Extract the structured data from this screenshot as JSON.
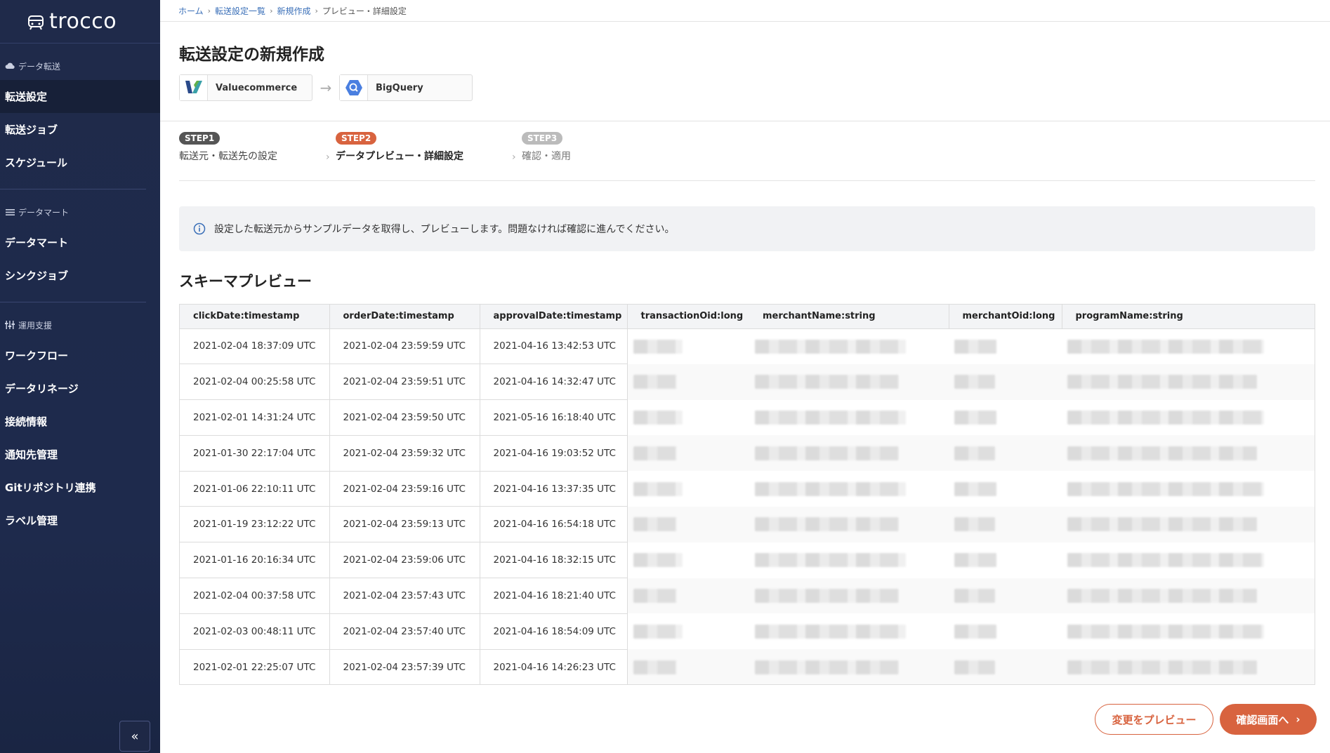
{
  "app": {
    "logo_text": "trocco"
  },
  "sidebar": {
    "sections": [
      {
        "heading": "データ転送",
        "icon": "cloud-icon",
        "items": [
          {
            "label": "転送設定",
            "active": true
          },
          {
            "label": "転送ジョブ"
          },
          {
            "label": "スケジュール"
          }
        ]
      },
      {
        "heading": "データマート",
        "icon": "list-icon",
        "items": [
          {
            "label": "データマート"
          },
          {
            "label": "シンクジョブ"
          }
        ]
      },
      {
        "heading": "運用支援",
        "icon": "sliders-icon",
        "items": [
          {
            "label": "ワークフロー"
          },
          {
            "label": "データリネージ"
          },
          {
            "label": "接続情報"
          },
          {
            "label": "通知先管理"
          },
          {
            "label": "Gitリポジトリ連携"
          },
          {
            "label": "ラベル管理"
          }
        ]
      }
    ],
    "collapse_glyph": "«"
  },
  "breadcrumb": [
    "ホーム",
    "転送設定一覧",
    "新規作成",
    "プレビュー・詳細設定"
  ],
  "page_title": "転送設定の新規作成",
  "connectors": {
    "source": "Valuecommerce",
    "destination": "BigQuery"
  },
  "steps": [
    {
      "badge": "STEP1",
      "label": "転送元・転送先の設定",
      "state": "done"
    },
    {
      "badge": "STEP2",
      "label": "データプレビュー・詳細設定",
      "state": "current"
    },
    {
      "badge": "STEP3",
      "label": "確認・適用",
      "state": "pending"
    }
  ],
  "info_message": "設定した転送元からサンプルデータを取得し、プレビューします。問題なければ確認に進んでください。",
  "schema_title": "スキーマプレビュー",
  "table": {
    "columns": [
      "clickDate:timestamp",
      "orderDate:timestamp",
      "approvalDate:timestamp",
      "transactionOid:long",
      "merchantName:string",
      "merchantOid:long",
      "programName:string"
    ],
    "rows": [
      [
        "2021-02-04 18:37:09 UTC",
        "2021-02-04 23:59:59 UTC",
        "2021-04-16 13:42:53 UTC"
      ],
      [
        "2021-02-04 00:25:58 UTC",
        "2021-02-04 23:59:51 UTC",
        "2021-04-16 14:32:47 UTC"
      ],
      [
        "2021-02-01 14:31:24 UTC",
        "2021-02-04 23:59:50 UTC",
        "2021-05-16 16:18:40 UTC"
      ],
      [
        "2021-01-30 22:17:04 UTC",
        "2021-02-04 23:59:32 UTC",
        "2021-04-16 19:03:52 UTC"
      ],
      [
        "2021-01-06 22:10:11 UTC",
        "2021-02-04 23:59:16 UTC",
        "2021-04-16 13:37:35 UTC"
      ],
      [
        "2021-01-19 23:12:22 UTC",
        "2021-02-04 23:59:13 UTC",
        "2021-04-16 16:54:18 UTC"
      ],
      [
        "2021-01-16 20:16:34 UTC",
        "2021-02-04 23:59:06 UTC",
        "2021-04-16 18:32:15 UTC"
      ],
      [
        "2021-02-04 00:37:58 UTC",
        "2021-02-04 23:57:43 UTC",
        "2021-04-16 18:21:40 UTC"
      ],
      [
        "2021-02-03 00:48:11 UTC",
        "2021-02-04 23:57:40 UTC",
        "2021-04-16 18:54:09 UTC"
      ],
      [
        "2021-02-01 22:25:07 UTC",
        "2021-02-04 23:57:39 UTC",
        "2021-04-16 14:26:23 UTC"
      ]
    ]
  },
  "buttons": {
    "preview_changes": "変更をプレビュー",
    "to_confirm": "確認画面へ"
  },
  "colors": {
    "sidebar_bg": "#1f2a4a",
    "accent": "#d8633f",
    "step_done": "#555555",
    "step_pending": "#bbbbbb",
    "link": "#3a6fb8"
  }
}
